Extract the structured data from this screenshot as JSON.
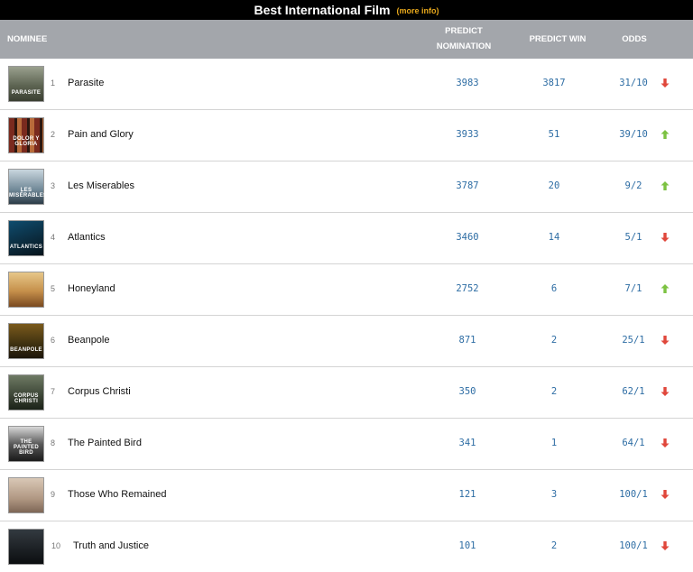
{
  "title": "Best International Film",
  "more_info": "(more info)",
  "columns": {
    "nominee": "NOMINEE",
    "predict_nomination": "PREDICT NOMINATION",
    "predict_win": "PREDICT WIN",
    "odds": "ODDS"
  },
  "colors": {
    "up": "#7cc241",
    "down": "#e0473b",
    "number": "#2e6da4"
  },
  "rows": [
    {
      "rank": "1",
      "name": "Parasite",
      "nom": "3983",
      "win": "3817",
      "odds": "31/10",
      "trend": "down",
      "poster_caption": "PARASITE"
    },
    {
      "rank": "2",
      "name": "Pain and Glory",
      "nom": "3933",
      "win": "51",
      "odds": "39/10",
      "trend": "up",
      "poster_caption": "DOLOR Y GLORIA"
    },
    {
      "rank": "3",
      "name": "Les Miserables",
      "nom": "3787",
      "win": "20",
      "odds": "9/2",
      "trend": "up",
      "poster_caption": "LES MISÉRABLES"
    },
    {
      "rank": "4",
      "name": "Atlantics",
      "nom": "3460",
      "win": "14",
      "odds": "5/1",
      "trend": "down",
      "poster_caption": "ATLANTICS"
    },
    {
      "rank": "5",
      "name": "Honeyland",
      "nom": "2752",
      "win": "6",
      "odds": "7/1",
      "trend": "up",
      "poster_caption": ""
    },
    {
      "rank": "6",
      "name": "Beanpole",
      "nom": "871",
      "win": "2",
      "odds": "25/1",
      "trend": "down",
      "poster_caption": "BEANPOLE"
    },
    {
      "rank": "7",
      "name": "Corpus Christi",
      "nom": "350",
      "win": "2",
      "odds": "62/1",
      "trend": "down",
      "poster_caption": "CORPUS CHRISTI"
    },
    {
      "rank": "8",
      "name": "The Painted Bird",
      "nom": "341",
      "win": "1",
      "odds": "64/1",
      "trend": "down",
      "poster_caption": "THE PAINTED BIRD"
    },
    {
      "rank": "9",
      "name": "Those Who Remained",
      "nom": "121",
      "win": "3",
      "odds": "100/1",
      "trend": "down",
      "poster_caption": ""
    },
    {
      "rank": "10",
      "name": "Truth and Justice",
      "nom": "101",
      "win": "2",
      "odds": "100/1",
      "trend": "down",
      "poster_caption": ""
    }
  ]
}
